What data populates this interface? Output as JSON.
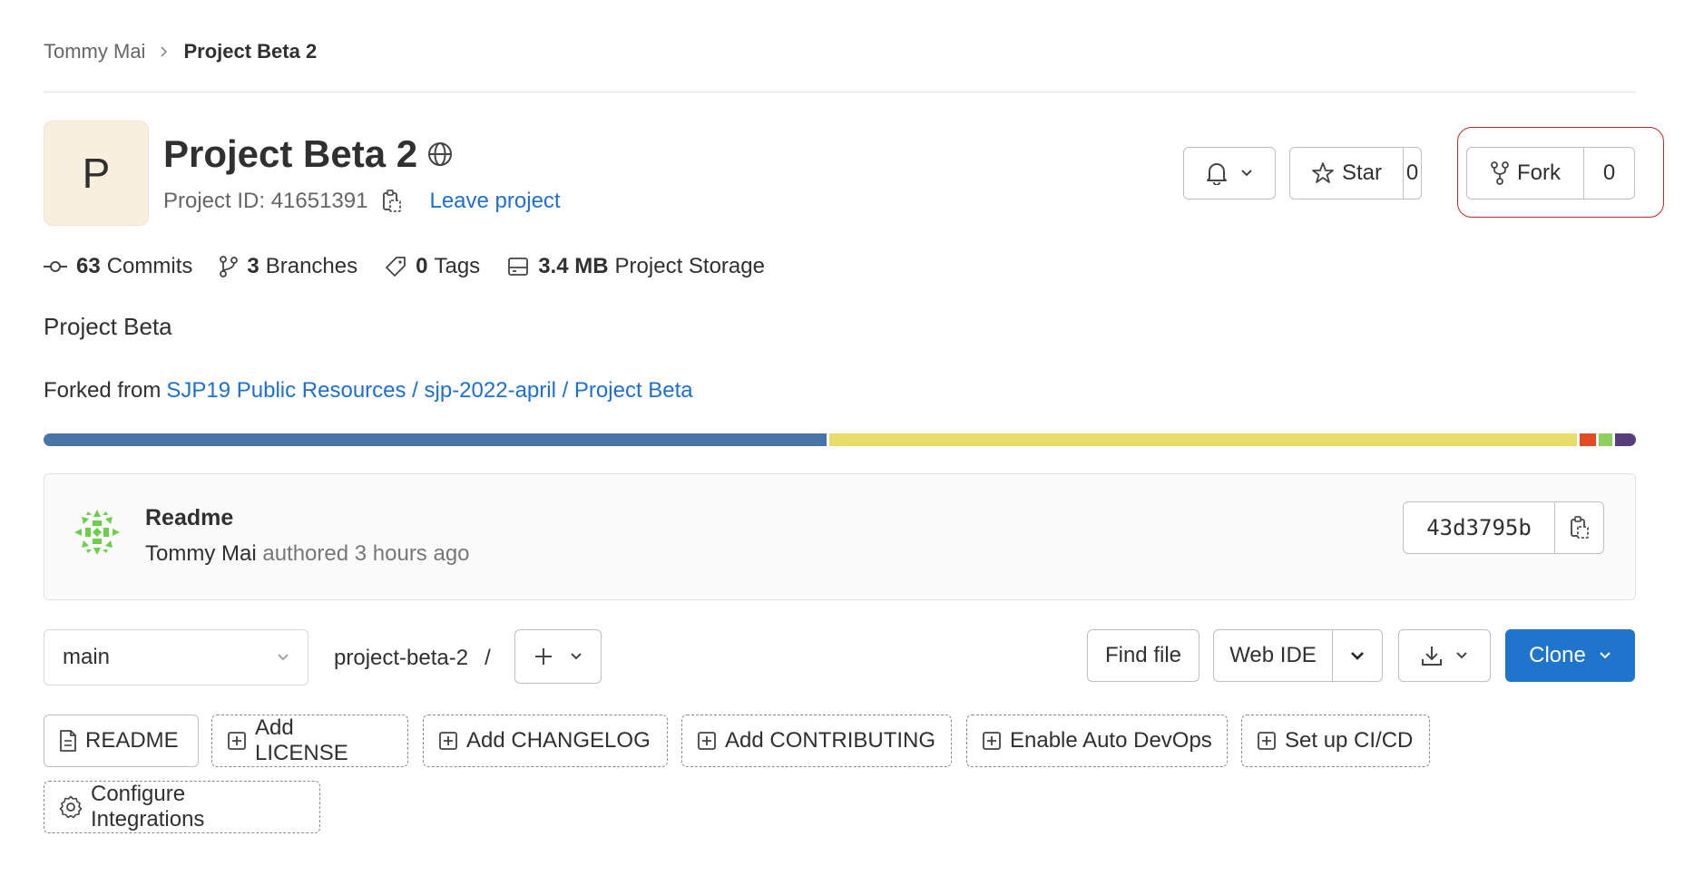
{
  "breadcrumb": {
    "parent": "Tommy Mai",
    "current": "Project Beta 2"
  },
  "project": {
    "avatar_letter": "P",
    "title": "Project Beta 2",
    "id_text": "Project ID: 41651391",
    "leave_link": "Leave project",
    "description": "Project Beta",
    "forked_prefix": "Forked from",
    "forked_link": "SJP19 Public Resources / sjp-2022-april / Project Beta"
  },
  "actions": {
    "star_label": "Star",
    "star_count": "0",
    "fork_label": "Fork",
    "fork_count": "0"
  },
  "stats": {
    "commits_num": "63",
    "commits_label": "Commits",
    "branches_num": "3",
    "branches_label": "Branches",
    "tags_num": "0",
    "tags_label": "Tags",
    "storage_num": "3.4 MB",
    "storage_label": "Project Storage"
  },
  "languages": [
    {
      "color": "#4a74a8",
      "share": 49.5
    },
    {
      "color": "#e8dc6a",
      "share": 47.3
    },
    {
      "color": "#e44b23",
      "share": 1.0
    },
    {
      "color": "#8ed05f",
      "share": 0.9
    },
    {
      "color": "#563d7c",
      "share": 1.3
    }
  ],
  "last_commit": {
    "title": "Readme",
    "author": "Tommy Mai",
    "meta": "authored 3 hours ago",
    "sha": "43d3795b"
  },
  "toolbar": {
    "branch": "main",
    "path": "project-beta-2",
    "path_sep": "/",
    "find_file": "Find file",
    "web_ide": "Web IDE",
    "clone": "Clone"
  },
  "quick_actions": {
    "readme": "README",
    "license": "Add LICENSE",
    "changelog": "Add CHANGELOG",
    "contributing": "Add CONTRIBUTING",
    "autodevops": "Enable Auto DevOps",
    "cicd": "Set up CI/CD",
    "integrations": "Configure Integrations"
  },
  "colors": {
    "link": "#1f6fd0",
    "clone_bg": "#1f75cb",
    "annotation": "#c02a2a"
  },
  "icons": [
    "chevron-right-icon",
    "globe-icon",
    "copy-icon",
    "bell-icon",
    "chevron-down-icon",
    "star-icon",
    "fork-icon",
    "commit-icon",
    "branch-icon",
    "tag-icon",
    "storage-icon",
    "plus-icon",
    "download-icon",
    "file-icon",
    "plus-square-icon",
    "gear-icon"
  ]
}
